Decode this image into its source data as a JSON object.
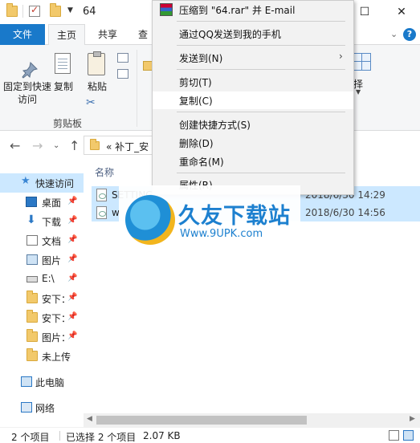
{
  "window": {
    "title": "64",
    "minimize_glyph": "—",
    "maximize_glyph": "☐",
    "close_glyph": "✕"
  },
  "ribbon_tabs": {
    "file": "文件",
    "home": "主页",
    "share": "共享",
    "view": "查"
  },
  "ribbon": {
    "pin_quick_access": "固定到快速访问",
    "copy": "复制",
    "paste": "粘贴",
    "clipboard_group": "剪贴板",
    "select_partial": "择"
  },
  "address": {
    "path_prefix": "«",
    "path_text": "补丁_安"
  },
  "nav_pane": {
    "items": [
      {
        "label": "快速访问",
        "icon": "star-icon"
      },
      {
        "label": "桌面",
        "icon": "desktop-icon"
      },
      {
        "label": "下载",
        "icon": "download-icon"
      },
      {
        "label": "文档",
        "icon": "document-icon"
      },
      {
        "label": "图片",
        "icon": "picture-icon"
      },
      {
        "label": "E:\\",
        "icon": "drive-icon"
      },
      {
        "label": "安下：",
        "icon": "folder-icon"
      },
      {
        "label": "安下：",
        "icon": "folder-icon"
      },
      {
        "label": "图片：",
        "icon": "folder-icon"
      },
      {
        "label": "未上传",
        "icon": "folder-icon"
      },
      {
        "label": "此电脑",
        "icon": "computer-icon"
      },
      {
        "label": "网络",
        "icon": "network-icon"
      }
    ]
  },
  "file_list": {
    "column_name": "名称",
    "rows": [
      {
        "name": "SETTING",
        "date": "2018/6/30 14:29"
      },
      {
        "name": "w",
        "date": "2018/6/30 14:56"
      }
    ]
  },
  "context_menu": {
    "items": [
      {
        "label": "压缩到 \"64.rar\" 并 E-mail"
      },
      {
        "label": "通过QQ发送到我的手机"
      },
      {
        "label": "发送到(N)"
      },
      {
        "label": "剪切(T)"
      },
      {
        "label": "复制(C)"
      },
      {
        "label": "创建快捷方式(S)"
      },
      {
        "label": "删除(D)"
      },
      {
        "label": "重命名(M)"
      },
      {
        "label": "属性(R)"
      }
    ]
  },
  "status": {
    "item_count": "2 个项目",
    "selected": "已选择 2 个项目",
    "size": "2.07 KB"
  },
  "watermark": {
    "title": "久友下载站",
    "url": "Www.9UPK.com"
  },
  "colors": {
    "accent": "#1979ca",
    "selection": "#cce8ff",
    "menu_bg": "#f2f2f2"
  }
}
